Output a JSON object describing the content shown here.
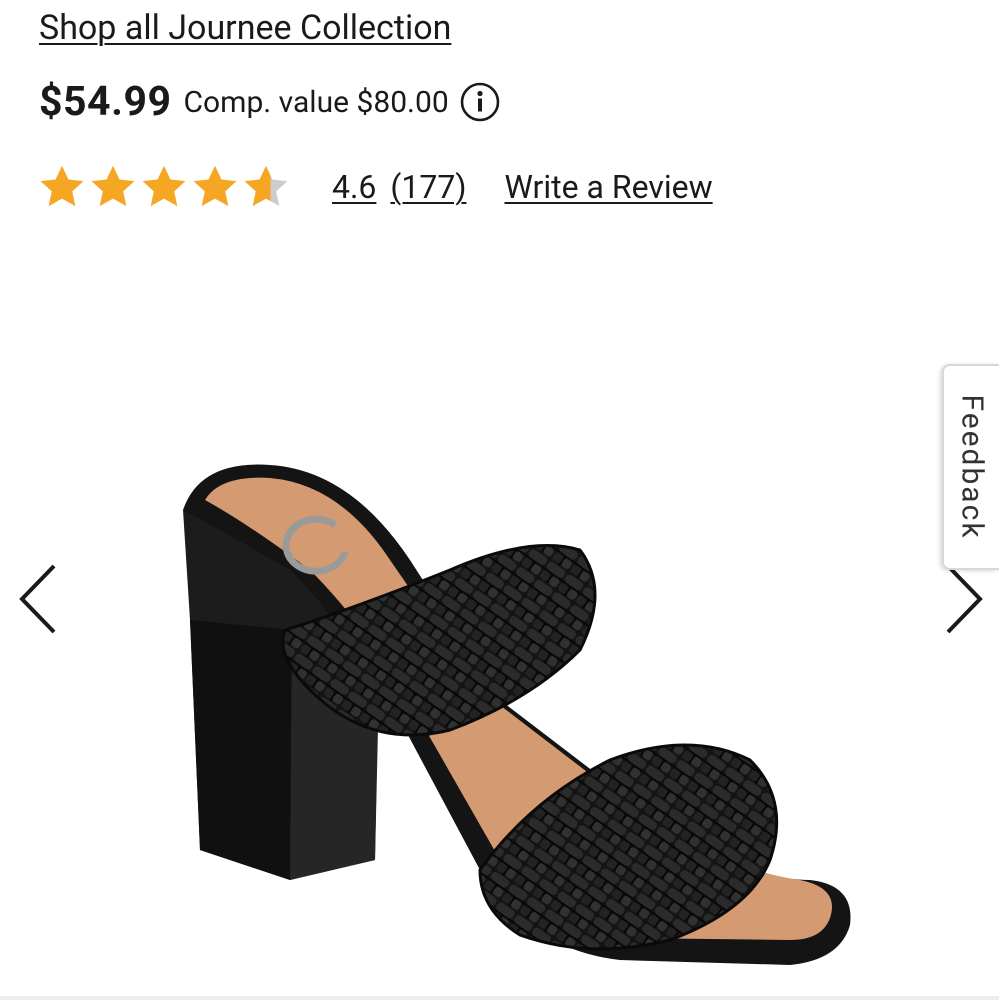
{
  "product": {
    "collection_link": "Shop all Journee Collection",
    "price": "$54.99",
    "comp_value": "Comp. value $80.00",
    "info_icon": "info-icon"
  },
  "rating": {
    "value": "4.6",
    "count": "(177)",
    "stars_filled": 4.6,
    "stars_total": 5,
    "star_color": "#f5a623",
    "star_empty_color": "#cccccc",
    "write_review": "Write a Review"
  },
  "carousel": {
    "prev_icon": "chevron-left-icon",
    "next_icon": "chevron-right-icon"
  },
  "feedback": {
    "label": "Feedback"
  }
}
